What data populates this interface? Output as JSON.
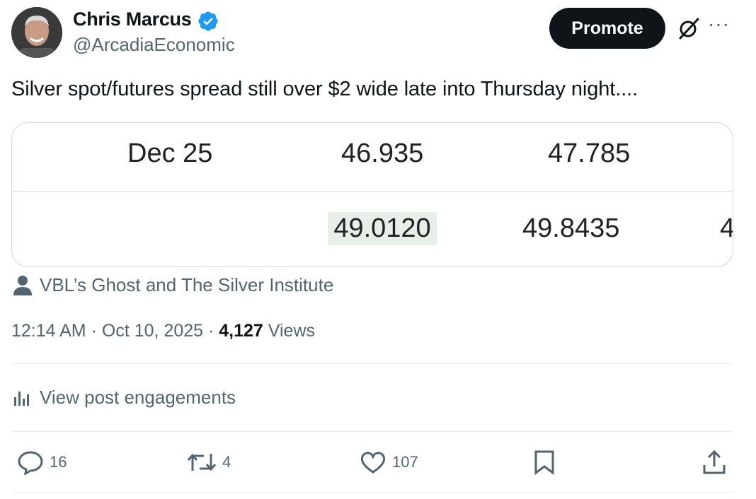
{
  "author": {
    "name": "Chris Marcus",
    "handle": "@ArcadiaEconomic"
  },
  "header": {
    "promote_label": "Promote",
    "more_label": "···"
  },
  "tweet": {
    "text": "Silver spot/futures spread still over $2 wide late into Thursday night...."
  },
  "media_table": {
    "rows": [
      [
        "Dec 25",
        "46.935",
        "47.785",
        ""
      ],
      [
        "",
        "49.0120",
        "49.8435",
        "4"
      ]
    ]
  },
  "source": {
    "label": "VBL’s Ghost and The Silver Institute"
  },
  "meta": {
    "time": "12:14 AM",
    "date": "Oct 10, 2025",
    "views_count": "4,127",
    "views_label": "Views"
  },
  "engagements": {
    "label": "View post engagements"
  },
  "actions": {
    "replies": "16",
    "reposts": "4",
    "likes": "107"
  },
  "colors": {
    "verified": "#1d9bf0",
    "secondary_text": "#536471",
    "primary_text": "#0f1419",
    "highlight": "#e8efe9"
  }
}
